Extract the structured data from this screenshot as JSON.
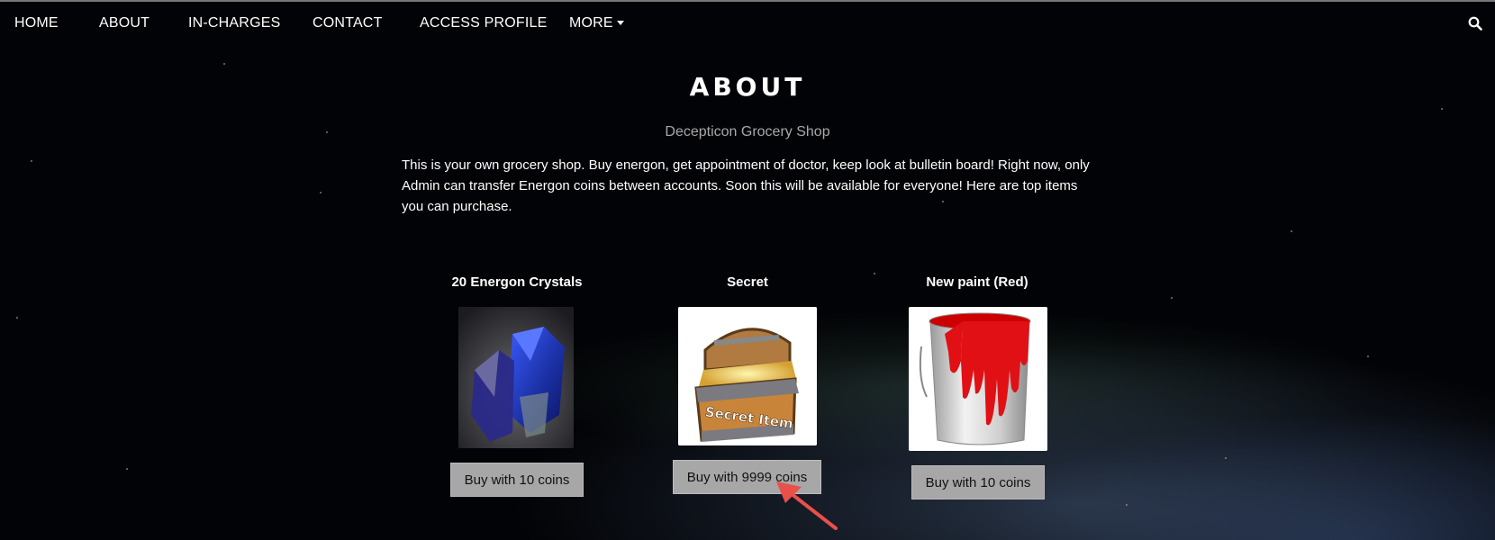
{
  "nav": {
    "items": [
      "HOME",
      "ABOUT",
      "IN-CHARGES",
      "CONTACT",
      "ACCESS PROFILE"
    ],
    "more_label": "MORE",
    "search_icon": "search-icon"
  },
  "section": {
    "title": "ABOUT",
    "subtitle": "Decepticon Grocery Shop",
    "description": "This is your own grocery shop. Buy energon, get appointment of doctor, keep look at bulletin board! Right now, only Admin can transfer Energon coins between accounts. Soon this will be available for everyone! Here are top items you can purchase."
  },
  "products": [
    {
      "name": "20 Energon Crystals",
      "button": "Buy with 10 coins",
      "image": "blue-crystal-image"
    },
    {
      "name": "Secret",
      "button": "Buy with 9999 coins",
      "image": "secret-item-chest-image"
    },
    {
      "name": "New paint (Red)",
      "button": "Buy with 10 coins",
      "image": "red-paint-bucket-image"
    }
  ],
  "colors": {
    "button_bg": "#a7a7a7",
    "arrow": "#e8504a",
    "paint": "#e01015"
  }
}
